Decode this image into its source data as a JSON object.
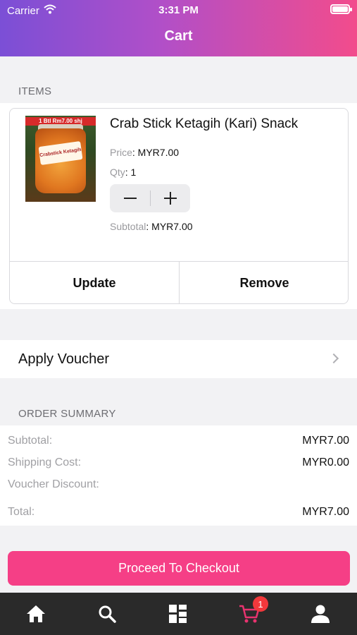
{
  "status_bar": {
    "carrier": "Carrier",
    "time": "3:31 PM"
  },
  "header": {
    "title": "Cart"
  },
  "items_section": {
    "label": "ITEMS"
  },
  "cart_item": {
    "image_tag": "1 Btl Rm7.00 shj",
    "image_label": "Crabstick Ketagih",
    "name": "Crab Stick Ketagih (Kari) Snack",
    "price_label": "Price",
    "price_value": ": MYR7.00",
    "qty_label": "Qty",
    "qty_value": ": 1",
    "subtotal_label": "Subtotal",
    "subtotal_value": ": MYR7.00",
    "update_label": "Update",
    "remove_label": "Remove"
  },
  "voucher": {
    "label": "Apply Voucher"
  },
  "order_summary": {
    "label": "ORDER SUMMARY",
    "rows": [
      {
        "key": "Subtotal:",
        "value": "MYR7.00"
      },
      {
        "key": "Shipping Cost:",
        "value": "MYR0.00"
      },
      {
        "key": "Voucher Discount:",
        "value": ""
      },
      {
        "key": "Total:",
        "value": "MYR7.00"
      }
    ]
  },
  "checkout": {
    "label": "Proceed To Checkout"
  },
  "tabbar": {
    "tabs": [
      {
        "icon": "home-icon"
      },
      {
        "icon": "search-icon"
      },
      {
        "icon": "categories-icon"
      },
      {
        "icon": "cart-icon",
        "badge": "1",
        "active": true
      },
      {
        "icon": "profile-icon"
      }
    ]
  },
  "colors": {
    "gradient_start": "#7b4fd6",
    "gradient_end": "#f24c8c",
    "checkout_button": "#f53f86",
    "active_tab": "#e8336f",
    "badge": "#f2383c",
    "tabbar_bg": "#2a2a2a"
  }
}
